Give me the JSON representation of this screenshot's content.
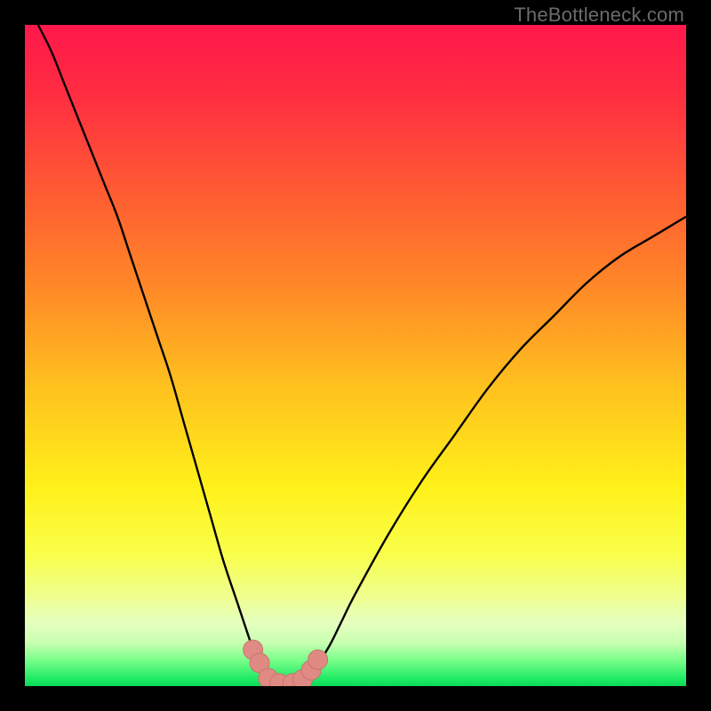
{
  "watermark": "TheBottleneck.com",
  "colors": {
    "frame": "#000000",
    "curve": "#000000",
    "marker_fill": "#e08a84",
    "marker_stroke": "#c6756f",
    "gradient_stops": [
      {
        "offset": 0.0,
        "color": "#ff184b"
      },
      {
        "offset": 0.1,
        "color": "#ff2c42"
      },
      {
        "offset": 0.25,
        "color": "#ff5a33"
      },
      {
        "offset": 0.4,
        "color": "#ff8a27"
      },
      {
        "offset": 0.55,
        "color": "#ffc21e"
      },
      {
        "offset": 0.7,
        "color": "#fff11a"
      },
      {
        "offset": 0.8,
        "color": "#f9ff4a"
      },
      {
        "offset": 0.86,
        "color": "#efff8a"
      },
      {
        "offset": 0.905,
        "color": "#e5ffc0"
      },
      {
        "offset": 0.935,
        "color": "#c8ffb0"
      },
      {
        "offset": 0.96,
        "color": "#7cff8a"
      },
      {
        "offset": 0.99,
        "color": "#1bea62"
      },
      {
        "offset": 1.0,
        "color": "#0fd858"
      }
    ]
  },
  "chart_data": {
    "type": "line",
    "title": "",
    "xlabel": "",
    "ylabel": "",
    "xlim": [
      0,
      100
    ],
    "ylim": [
      0,
      100
    ],
    "grid": false,
    "legend": false,
    "note": "V-shaped curve; y=0 is optimal (bottom, green), y=100 worst (top, red). Minimum near x≈36–42.",
    "series": [
      {
        "name": "curve",
        "x": [
          2,
          4,
          6,
          8,
          10,
          12,
          14,
          16,
          18,
          20,
          22,
          24,
          26,
          28,
          30,
          32,
          34,
          35,
          36,
          38,
          40,
          42,
          44,
          46,
          48,
          50,
          55,
          60,
          65,
          70,
          75,
          80,
          85,
          90,
          95,
          100
        ],
        "y": [
          100,
          96,
          91,
          86,
          81,
          76,
          71,
          65,
          59,
          53,
          47,
          40,
          33,
          26,
          19,
          13,
          7,
          4,
          1.5,
          0.3,
          0.3,
          1.0,
          3,
          6,
          10,
          14,
          23,
          31,
          38,
          45,
          51,
          56,
          61,
          65,
          68,
          71
        ]
      }
    ],
    "markers": [
      {
        "x": 34.5,
        "y": 5.5
      },
      {
        "x": 35.5,
        "y": 3.5
      },
      {
        "x": 36.8,
        "y": 1.2
      },
      {
        "x": 38.5,
        "y": 0.4
      },
      {
        "x": 40.5,
        "y": 0.4
      },
      {
        "x": 42.0,
        "y": 1.0
      },
      {
        "x": 43.3,
        "y": 2.4
      },
      {
        "x": 44.3,
        "y": 4.0
      }
    ]
  }
}
